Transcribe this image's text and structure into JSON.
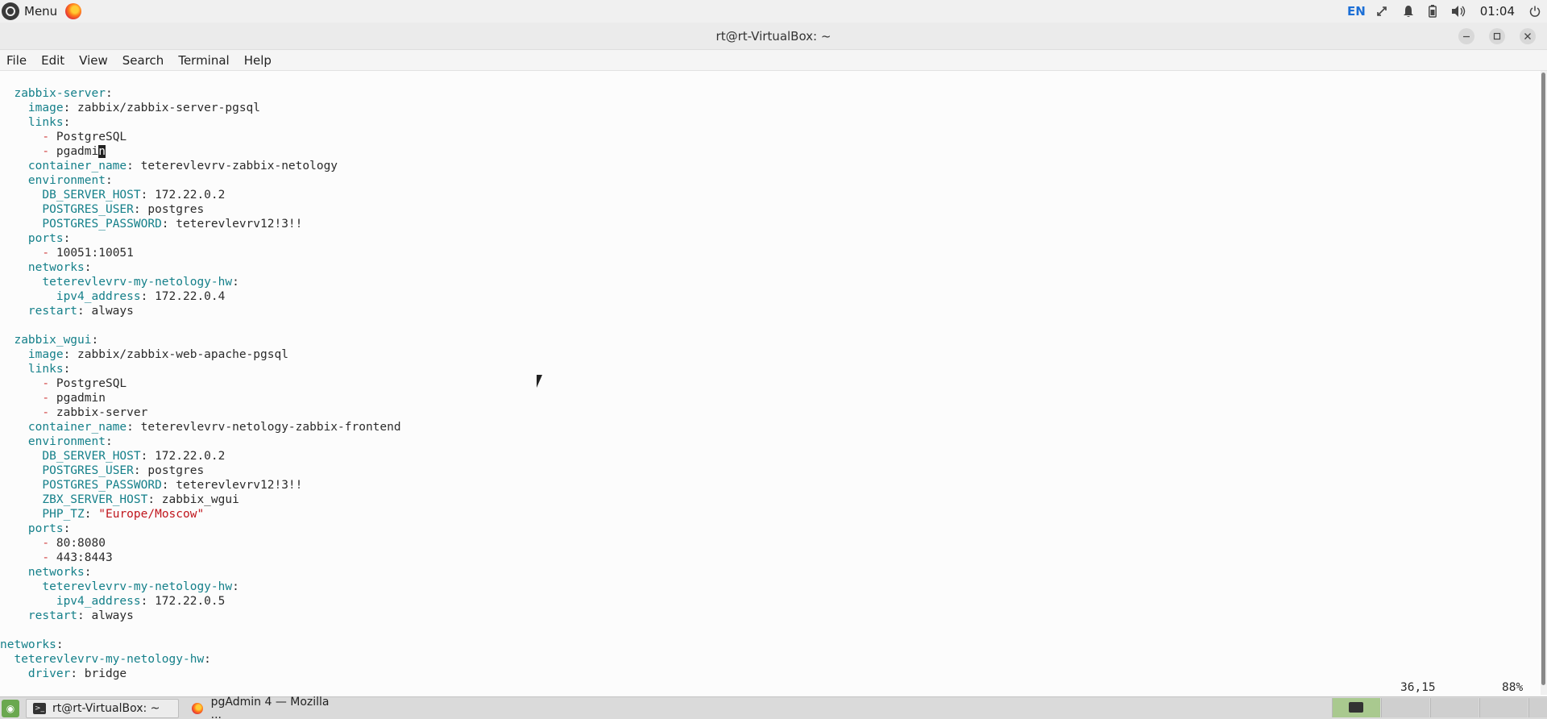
{
  "top_panel": {
    "menu_label": "Menu",
    "lang": "EN",
    "clock": "01:04"
  },
  "window": {
    "title": "rt@rt-VirtualBox: ~"
  },
  "menu_bar": [
    "File",
    "Edit",
    "View",
    "Search",
    "Terminal",
    "Help"
  ],
  "terminal": {
    "lines": [
      {
        "i": "  ",
        "k": "zabbix-server",
        "s": ":",
        "v": ""
      },
      {
        "i": "    ",
        "k": "image",
        "s": ":",
        "v": " zabbix/zabbix-server-pgsql"
      },
      {
        "i": "    ",
        "k": "links",
        "s": ":",
        "v": ""
      },
      {
        "i": "      ",
        "d": "- ",
        "v": "PostgreSQL"
      },
      {
        "i": "      ",
        "d": "- ",
        "v": "pgadmi",
        "c": "n"
      },
      {
        "i": "    ",
        "k": "container_name",
        "s": ":",
        "v": " teterevlevrv-zabbix-netology"
      },
      {
        "i": "    ",
        "k": "environment",
        "s": ":",
        "v": ""
      },
      {
        "i": "      ",
        "k": "DB_SERVER_HOST",
        "s": ":",
        "v": " 172.22.0.2"
      },
      {
        "i": "      ",
        "k": "POSTGRES_USER",
        "s": ":",
        "v": " postgres"
      },
      {
        "i": "      ",
        "k": "POSTGRES_PASSWORD",
        "s": ":",
        "v": " teterevlevrv12!3!!"
      },
      {
        "i": "    ",
        "k": "ports",
        "s": ":",
        "v": ""
      },
      {
        "i": "      ",
        "d": "- ",
        "v": "10051:10051"
      },
      {
        "i": "    ",
        "k": "networks",
        "s": ":",
        "v": ""
      },
      {
        "i": "      ",
        "k": "teterevlevrv-my-netology-hw",
        "s": ":",
        "v": ""
      },
      {
        "i": "        ",
        "k": "ipv4_address",
        "s": ":",
        "v": " 172.22.0.4"
      },
      {
        "i": "    ",
        "k": "restart",
        "s": ":",
        "v": " always"
      },
      {
        "i": "",
        "v": ""
      },
      {
        "i": "  ",
        "k": "zabbix_wgui",
        "s": ":",
        "v": ""
      },
      {
        "i": "    ",
        "k": "image",
        "s": ":",
        "v": " zabbix/zabbix-web-apache-pgsql"
      },
      {
        "i": "    ",
        "k": "links",
        "s": ":",
        "v": ""
      },
      {
        "i": "      ",
        "d": "- ",
        "v": "PostgreSQL"
      },
      {
        "i": "      ",
        "d": "- ",
        "v": "pgadmin"
      },
      {
        "i": "      ",
        "d": "- ",
        "v": "zabbix-server"
      },
      {
        "i": "    ",
        "k": "container_name",
        "s": ":",
        "v": " teterevlevrv-netology-zabbix-frontend"
      },
      {
        "i": "    ",
        "k": "environment",
        "s": ":",
        "v": ""
      },
      {
        "i": "      ",
        "k": "DB_SERVER_HOST",
        "s": ":",
        "v": " 172.22.0.2"
      },
      {
        "i": "      ",
        "k": "POSTGRES_USER",
        "s": ":",
        "v": " postgres"
      },
      {
        "i": "      ",
        "k": "POSTGRES_PASSWORD",
        "s": ":",
        "v": " teterevlevrv12!3!!"
      },
      {
        "i": "      ",
        "k": "ZBX_SERVER_HOST",
        "s": ":",
        "v": " zabbix_wgui"
      },
      {
        "i": "      ",
        "k": "PHP_TZ",
        "s": ":",
        "v": " ",
        "q": "\"Europe/Moscow\""
      },
      {
        "i": "    ",
        "k": "ports",
        "s": ":",
        "v": ""
      },
      {
        "i": "      ",
        "d": "- ",
        "v": "80:8080"
      },
      {
        "i": "      ",
        "d": "- ",
        "v": "443:8443"
      },
      {
        "i": "    ",
        "k": "networks",
        "s": ":",
        "v": ""
      },
      {
        "i": "      ",
        "k": "teterevlevrv-my-netology-hw",
        "s": ":",
        "v": ""
      },
      {
        "i": "        ",
        "k": "ipv4_address",
        "s": ":",
        "v": " 172.22.0.5"
      },
      {
        "i": "    ",
        "k": "restart",
        "s": ":",
        "v": " always"
      },
      {
        "i": "",
        "v": ""
      },
      {
        "i": "",
        "k": "networks",
        "s": ":",
        "v": ""
      },
      {
        "i": "  ",
        "k": "teterevlevrv-my-netology-hw",
        "s": ":",
        "v": ""
      },
      {
        "i": "    ",
        "k": "driver",
        "s": ":",
        "v": " bridge"
      }
    ],
    "status_position": "36,15",
    "status_percent": "88%"
  },
  "taskbar": {
    "tasks": [
      {
        "label": "rt@rt-VirtualBox: ~",
        "icon": "terminal-icon"
      },
      {
        "label": "pgAdmin 4 — Mozilla ...",
        "icon": "firefox-icon"
      }
    ]
  },
  "colors": {
    "key": "#15808a",
    "dash": "#d04040",
    "string": "#c0151c"
  }
}
